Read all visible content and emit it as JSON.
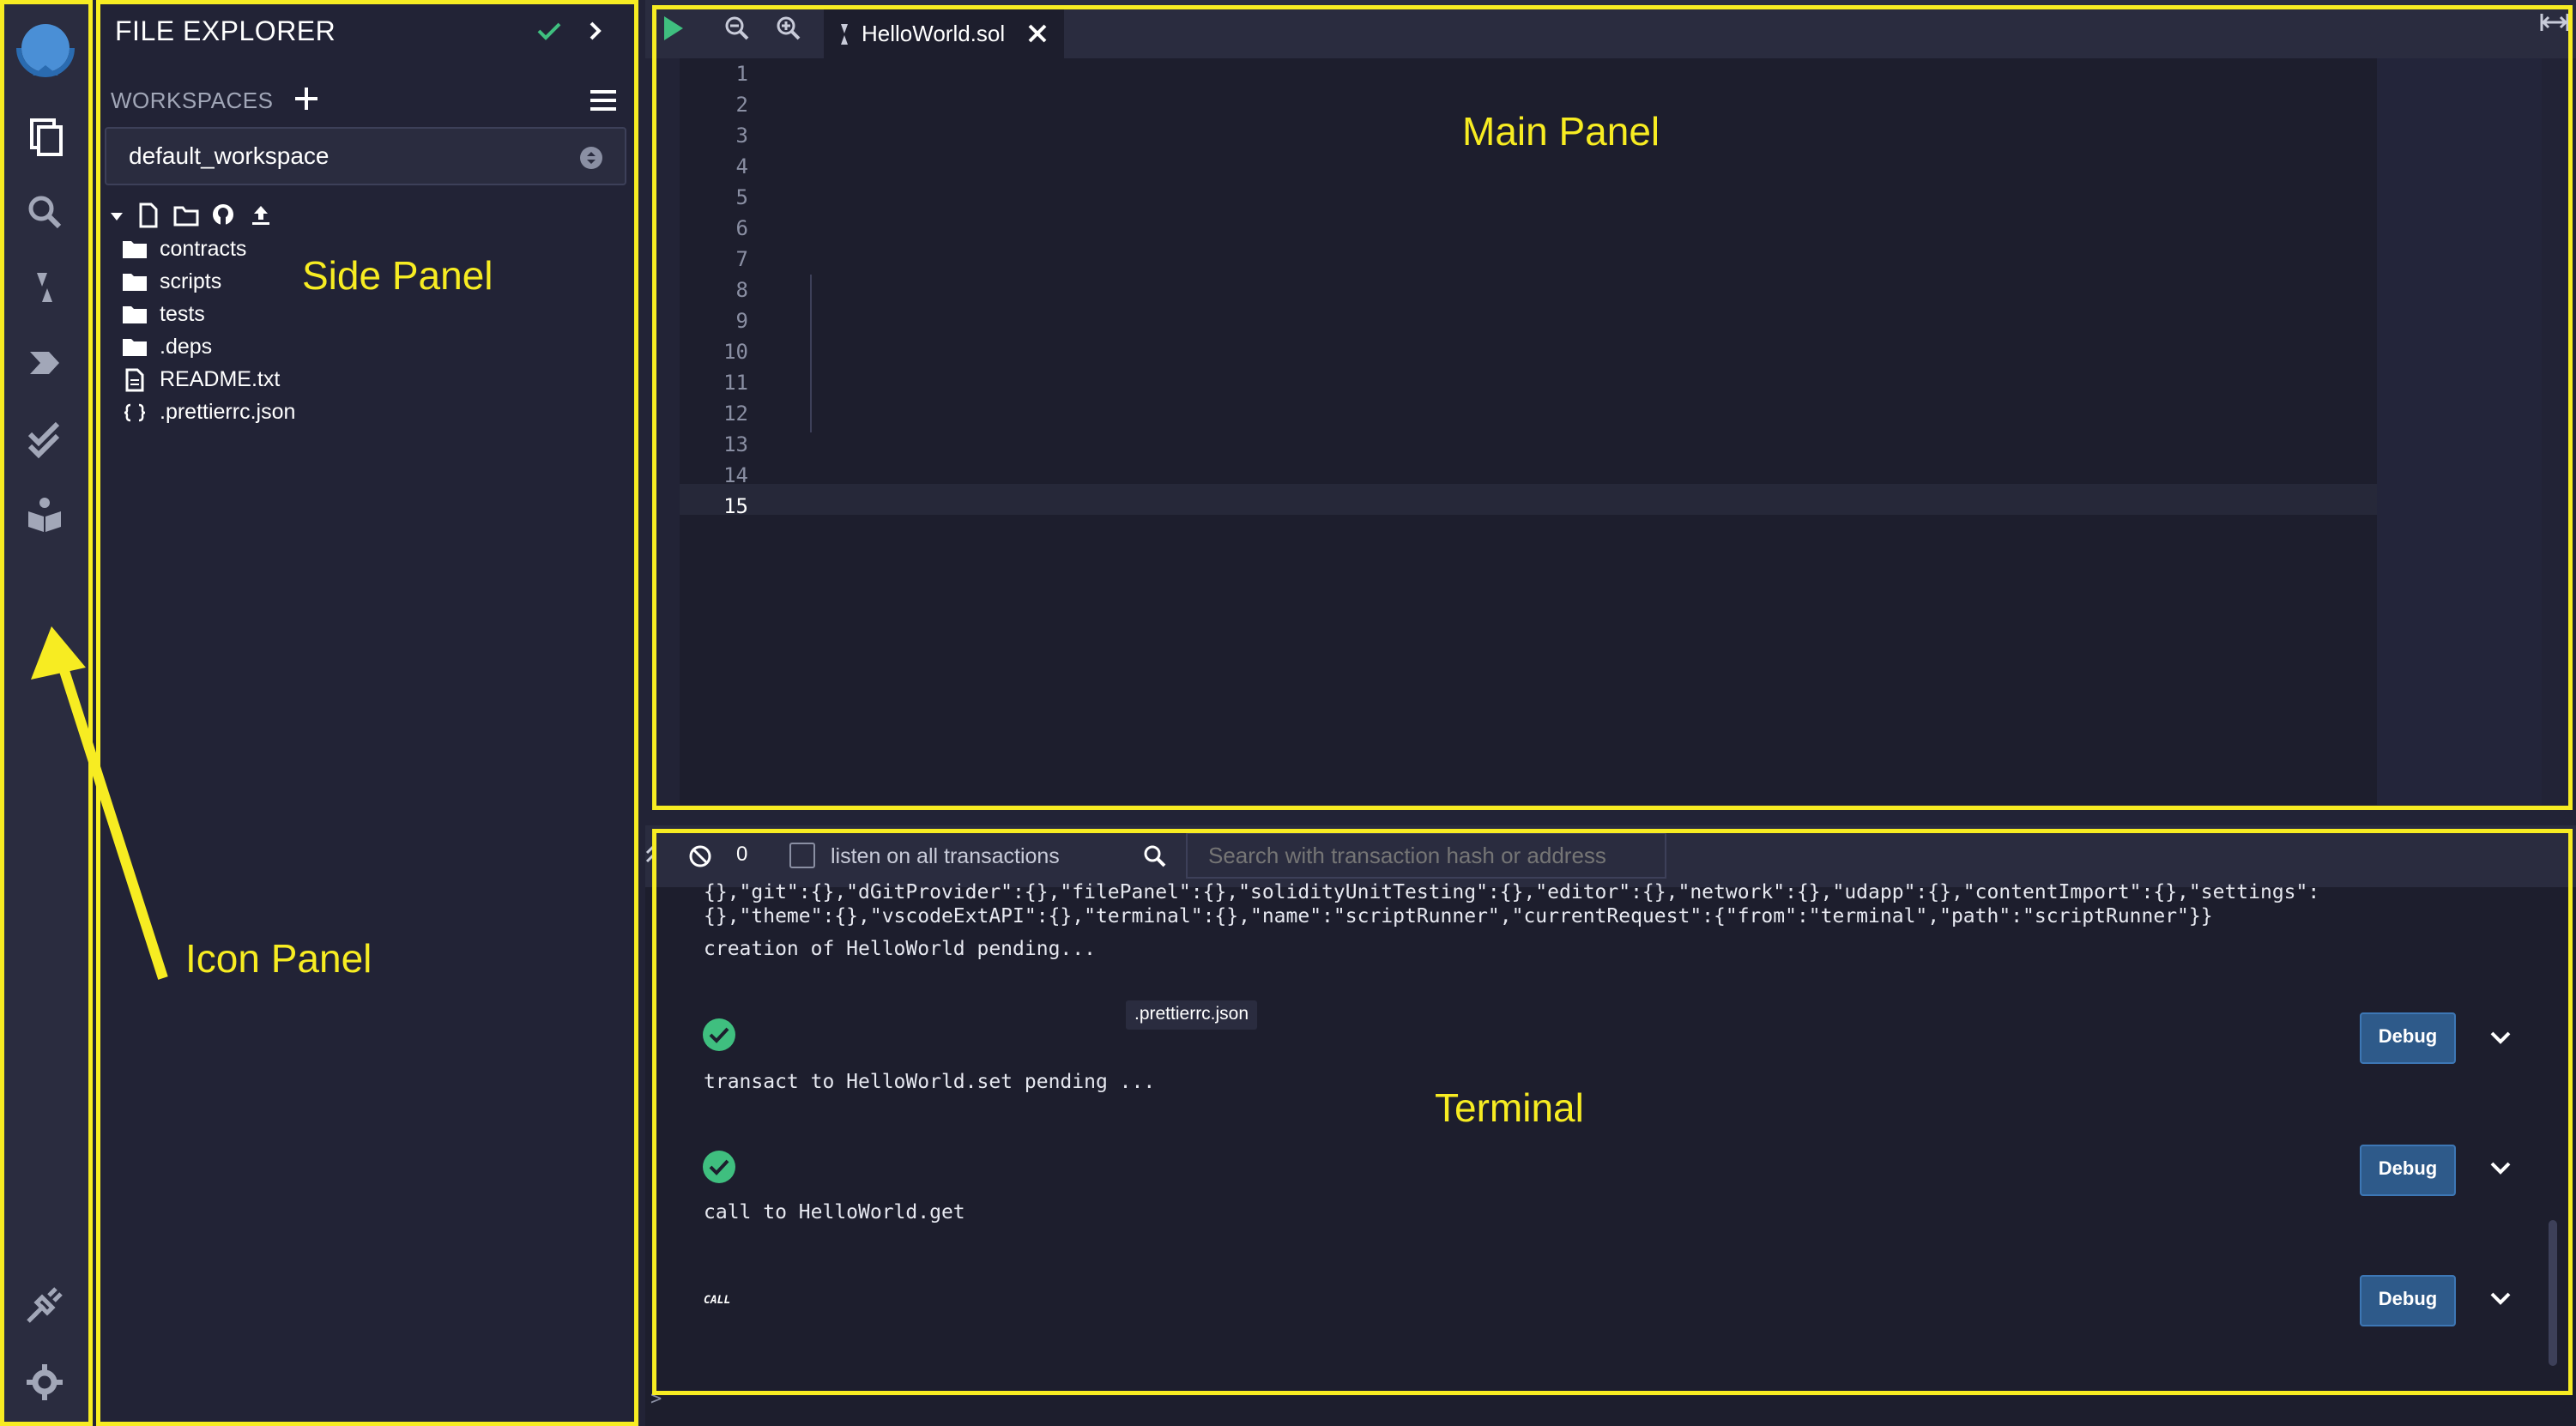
{
  "side_panel": {
    "title": "FILE EXPLORER",
    "workspaces_label": "WORKSPACES",
    "workspace_selected": "default_workspace",
    "tree": [
      {
        "label": "contracts",
        "icon": "folder-icon"
      },
      {
        "label": "scripts",
        "icon": "folder-icon"
      },
      {
        "label": "tests",
        "icon": "folder-icon"
      },
      {
        "label": ".deps",
        "icon": "folder-icon"
      },
      {
        "label": "README.txt",
        "icon": "file-text-icon"
      },
      {
        "label": ".prettierrc.json",
        "icon": "json-icon"
      }
    ]
  },
  "main_panel": {
    "tab_label": "HelloWorld.sol",
    "line_numbers": [
      "1",
      "2",
      "3",
      "4",
      "5",
      "6",
      "7",
      "8",
      "9",
      "10",
      "11",
      "12",
      "13",
      "14",
      "15"
    ]
  },
  "terminal": {
    "count": "0",
    "listen_label": "listen on all transactions",
    "search_placeholder": "Search with transaction hash or address",
    "log_line_1": "{},\"git\":{},\"dGitProvider\":{},\"filePanel\":{},\"solidityUnitTesting\":{},\"editor\":{},\"network\":{},\"udapp\":{},\"contentImport\":{},\"settings\":",
    "log_line_2": "{},\"theme\":{},\"vscodeExtAPI\":{},\"terminal\":{},\"name\":\"scriptRunner\",\"currentRequest\":{\"from\":\"terminal\",\"path\":\"scriptRunner\"}}",
    "pending_1": "creation of HelloWorld pending...",
    "pending_2": "transact to HelloWorld.set pending ...",
    "pending_3": "call to HelloWorld.get",
    "tooltip": ".prettierrc.json",
    "call_badge": "CALL",
    "debug_label": "Debug",
    "prompt": ">"
  },
  "annotations": {
    "icon_panel": "Icon Panel",
    "side_panel": "Side Panel",
    "main_panel": "Main Panel",
    "terminal": "Terminal"
  },
  "colors": {
    "annotation": "#f7ec22",
    "success": "#3fbf7f",
    "debug_button": "#2e5a8a"
  }
}
